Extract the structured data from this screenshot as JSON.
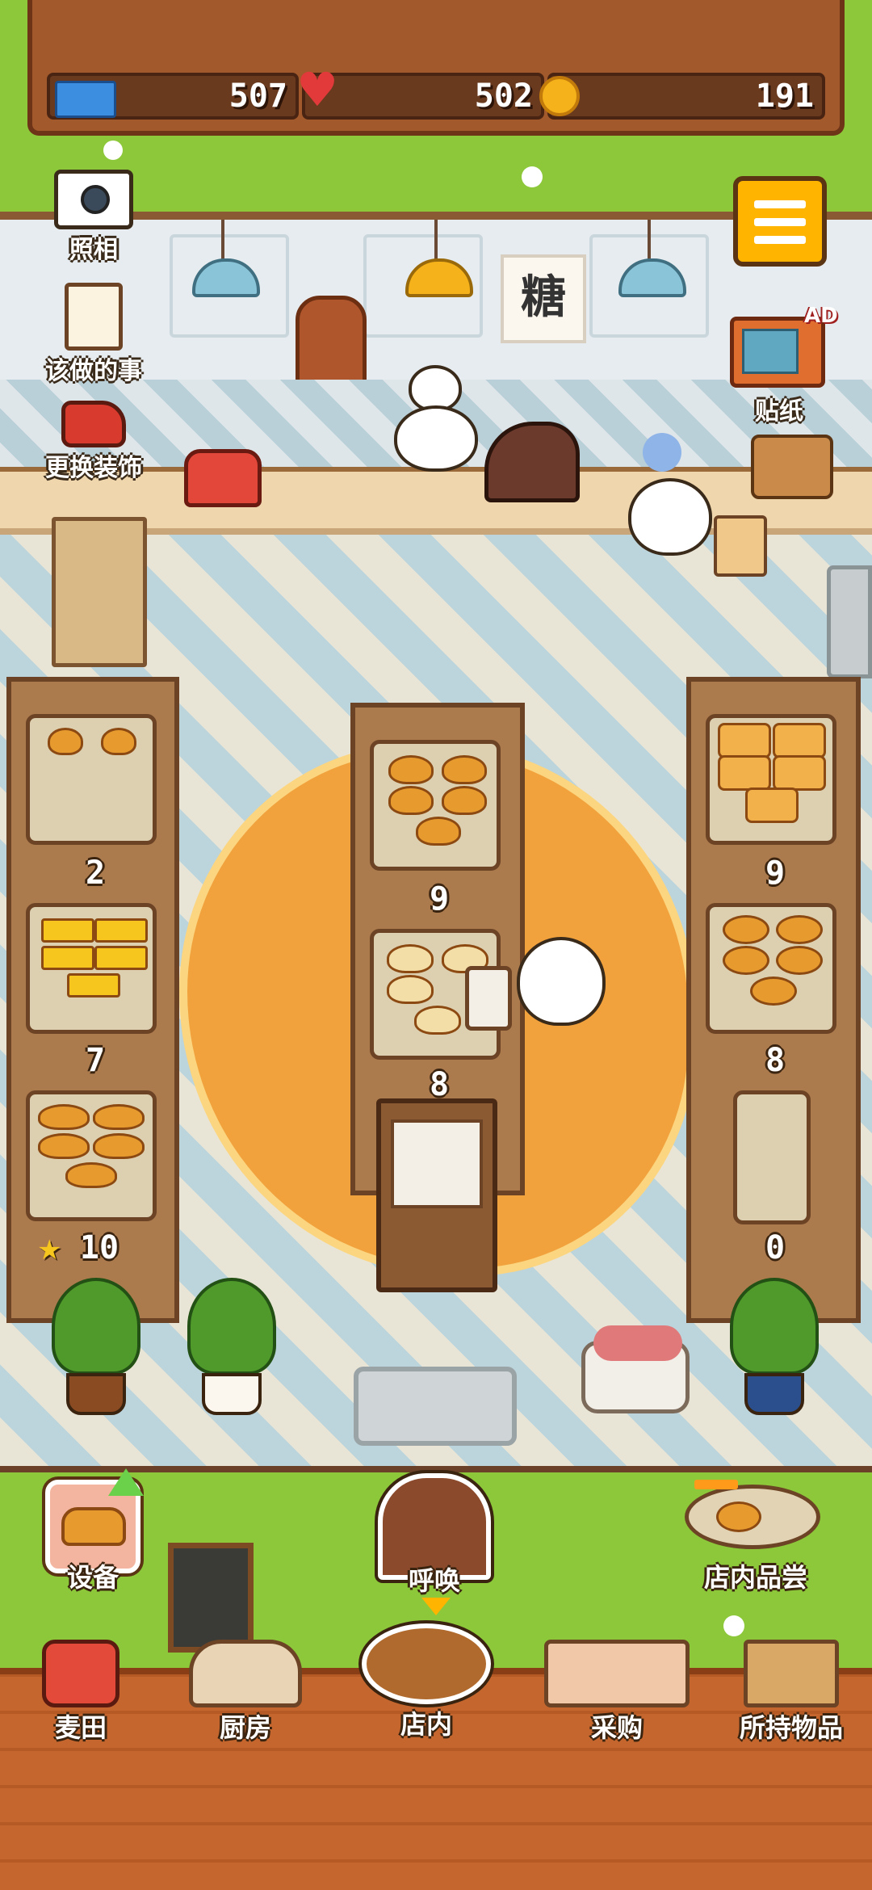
{
  "hud": {
    "tickets": "507",
    "hearts": "502",
    "coins": "191"
  },
  "side_menu": {
    "camera_label": "照相",
    "todo_label": "该做的事",
    "decor_label": "更换装饰"
  },
  "wall_sign": "糖",
  "ad_badge": "AD",
  "sticker_label": "贴纸",
  "shelves": {
    "left": [
      "2",
      "7",
      "10"
    ],
    "center": [
      "9",
      "8"
    ],
    "right": [
      "9",
      "8",
      "0"
    ]
  },
  "bottom_actions": {
    "equipment_label": "设备",
    "call_label": "呼唤",
    "tasting_label": "店内品尝"
  },
  "nav": {
    "field": "麦田",
    "kitchen": "厨房",
    "store": "店内",
    "purchase": "采购",
    "inventory": "所持物品"
  },
  "colors": {
    "grass": "#8cc83a",
    "wood": "#a2592b",
    "accent": "#ffb400"
  }
}
